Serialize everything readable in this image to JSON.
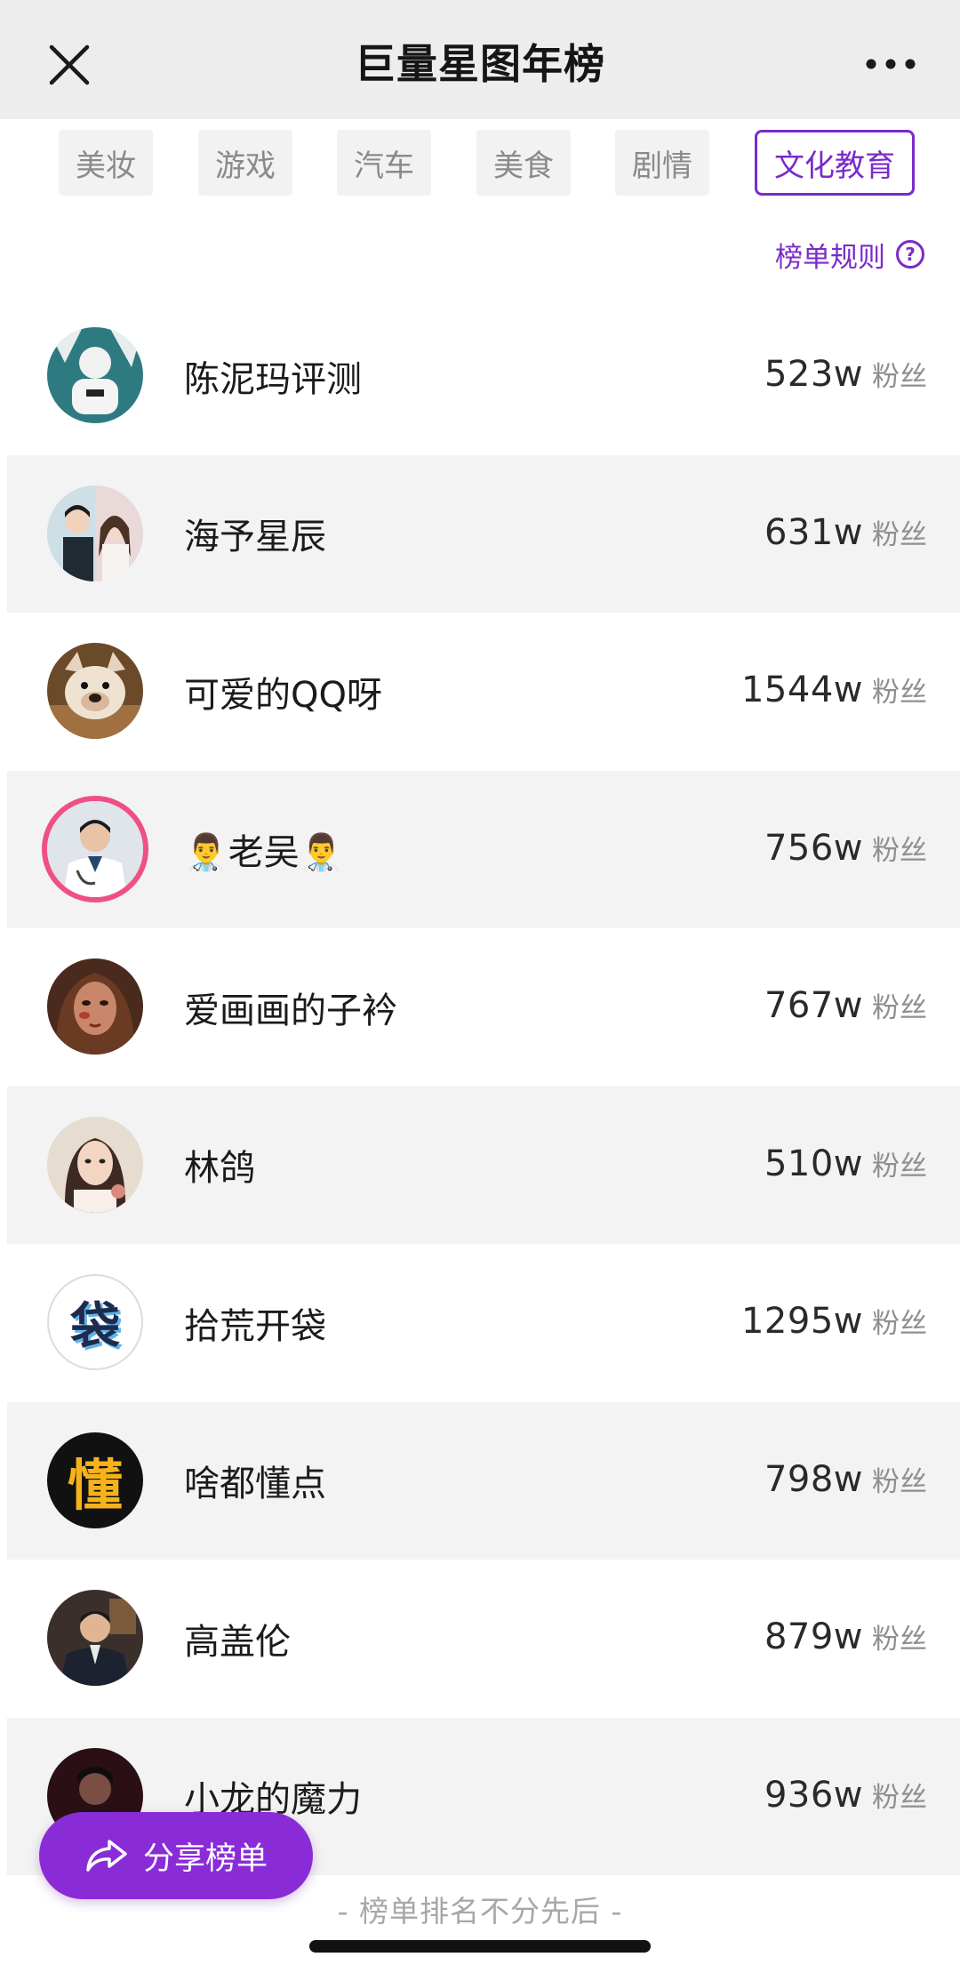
{
  "header": {
    "title": "巨量星图年榜"
  },
  "tabs": [
    {
      "label": "美妆"
    },
    {
      "label": "游戏"
    },
    {
      "label": "汽车"
    },
    {
      "label": "美食"
    },
    {
      "label": "剧情"
    },
    {
      "label": "文化教育"
    }
  ],
  "active_tab": "文化教育",
  "rules_label": "榜单规则",
  "fans_unit": "粉丝",
  "list": [
    {
      "name": "陈泥玛评测",
      "fans": "523w",
      "avatar": "person-avatar"
    },
    {
      "name": "海予星辰",
      "fans": "631w",
      "avatar": "couple-avatar"
    },
    {
      "name": "可爱的QQ呀",
      "fans": "1544w",
      "avatar": "dog-avatar"
    },
    {
      "name": "👨‍⚕️老吴👨‍⚕️",
      "fans": "756w",
      "avatar": "doctor-avatar"
    },
    {
      "name": "爱画画的子衿",
      "fans": "767w",
      "avatar": "portrait-avatar"
    },
    {
      "name": "林鸽",
      "fans": "510w",
      "avatar": "woman-avatar"
    },
    {
      "name": "拾荒开袋",
      "fans": "1295w",
      "avatar": "袋",
      "avatar_char": "袋"
    },
    {
      "name": "啥都懂点",
      "fans": "798w",
      "avatar": "懂",
      "avatar_char": "懂"
    },
    {
      "name": "高盖伦",
      "fans": "879w",
      "avatar": "man-avatar"
    },
    {
      "name": "小龙的魔力",
      "fans": "936w",
      "avatar": "dark-avatar"
    }
  ],
  "share_label": "分享榜单",
  "footer_note": "- 榜单排名不分先后 -",
  "colors": {
    "accent": "#7a2bc9",
    "share_bg": "#8a2bd8",
    "doctor_ring": "#f04f86"
  }
}
